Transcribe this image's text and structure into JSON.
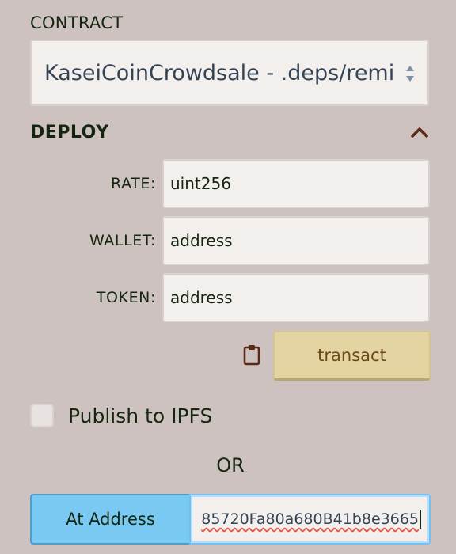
{
  "contract": {
    "label": "CONTRACT",
    "selected": "KaseiCoinCrowdsale - .deps/remix-tests/KaseiCoinCrowdsale.sol"
  },
  "deploy": {
    "header": "DEPLOY",
    "params": [
      {
        "label": "RATE:",
        "placeholder": "uint256"
      },
      {
        "label": "WALLET:",
        "placeholder": "address"
      },
      {
        "label": "TOKEN:",
        "placeholder": "address"
      }
    ],
    "transact_label": "transact"
  },
  "publish": {
    "label": "Publish to IPFS",
    "checked": false
  },
  "or_label": "OR",
  "at_address": {
    "button_label": "At Address",
    "value": "85720Fa80a680B41b8e3665"
  },
  "colors": {
    "background": "#cdc2bf",
    "transact": "#e3d4a1",
    "at_address": "#79c9f3"
  }
}
